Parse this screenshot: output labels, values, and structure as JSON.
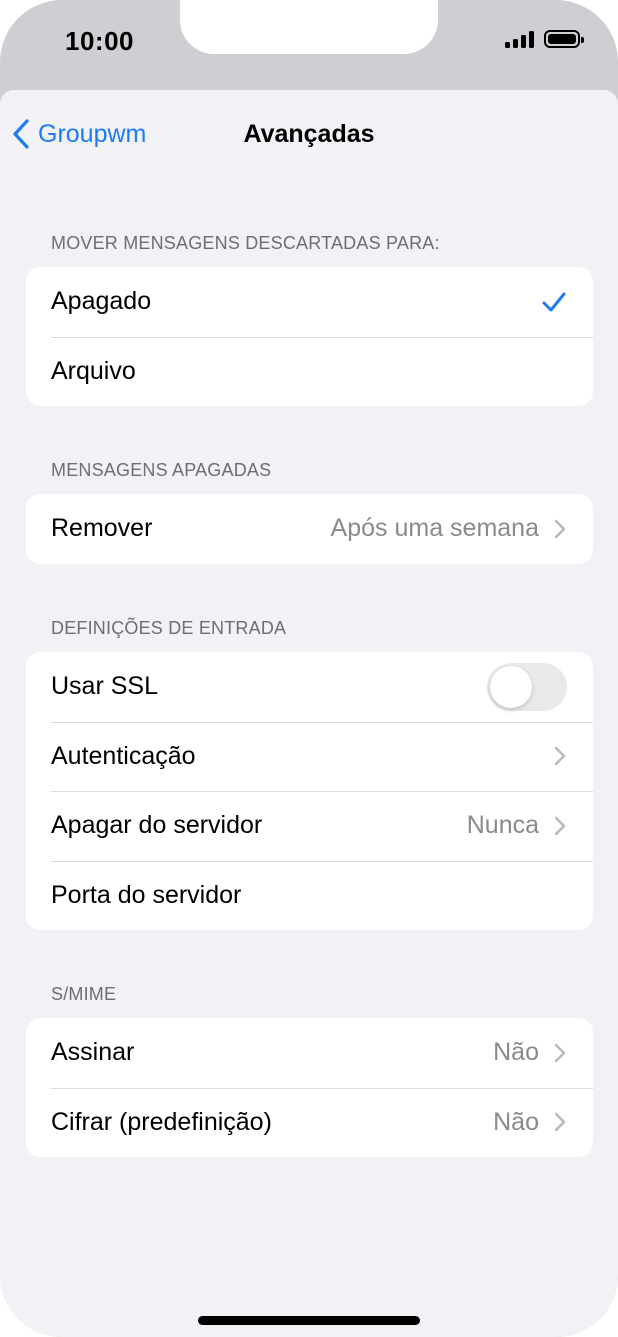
{
  "status_bar": {
    "time": "10:00"
  },
  "nav": {
    "back_label": "Groupwm",
    "title": "Avançadas"
  },
  "sections": {
    "move_deleted": {
      "header": "MOVER MENSAGENS DESCARTADAS PARA:",
      "options": [
        {
          "label": "Apagado",
          "selected": true
        },
        {
          "label": "Arquivo",
          "selected": false
        }
      ]
    },
    "deleted_messages": {
      "header": "MENSAGENS APAGADAS",
      "remove": {
        "label": "Remover",
        "value": "Após uma semana"
      }
    },
    "incoming": {
      "header": "DEFINIÇÕES DE ENTRADA",
      "use_ssl": {
        "label": "Usar SSL",
        "on": false
      },
      "authentication": {
        "label": "Autenticação"
      },
      "delete_from_server": {
        "label": "Apagar do servidor",
        "value": "Nunca"
      },
      "server_port": {
        "label": "Porta do servidor"
      }
    },
    "smime": {
      "header": "S/MIME",
      "sign": {
        "label": "Assinar",
        "value": "Não"
      },
      "encrypt": {
        "label": "Cifrar (predefinição)",
        "value": "Não"
      }
    }
  },
  "colors": {
    "accent": "#1d7cf2",
    "background": "#f1f1f6",
    "secondary_text": "#8a8a8e"
  },
  "icons": [
    "back-chevron-icon",
    "checkmark-icon",
    "chevron-right-icon",
    "signal-icon",
    "battery-icon"
  ]
}
